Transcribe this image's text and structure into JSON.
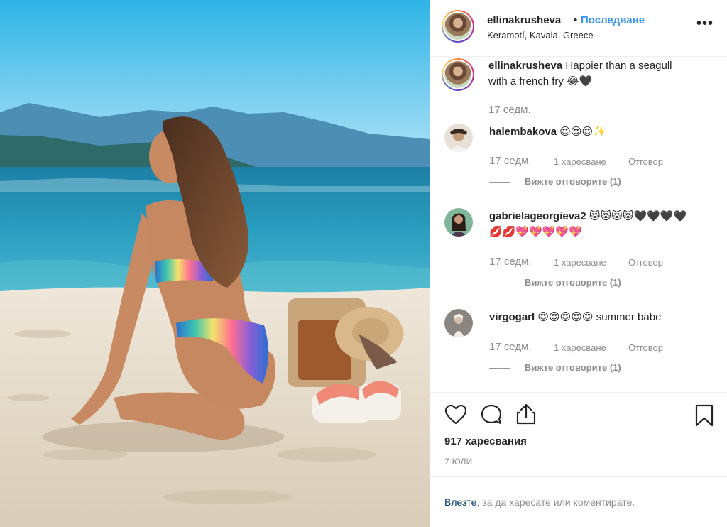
{
  "post": {
    "username": "ellinakrusheva",
    "separator": "•",
    "follow_label": "Последване",
    "location": "Keramotí, Kavala, Greece",
    "more_label": "•••"
  },
  "caption": {
    "username": "ellinakrusheva",
    "text": " Happier than a seagull",
    "text_line2": "with a french fry 😂🖤",
    "time": "17 седм."
  },
  "comments": [
    {
      "username": "halembakova",
      "text": " 😍😍😍✨",
      "time": "17 седм.",
      "likes": "1 харесване",
      "reply": "Отговор",
      "view_replies": "Вижте отговорите (1)"
    },
    {
      "username": "gabrielageorgieva2",
      "text": " 😻😻😻😻🖤🖤🖤🖤",
      "text_line2": "💋💋💖💖💖💖💖",
      "time": "17 седм.",
      "likes": "1 харесване",
      "reply": "Отговор",
      "view_replies": "Вижте отговорите (1)"
    },
    {
      "username": "virgogarl",
      "text": " 😍😍😍😍😍 summer babe",
      "time": "17 седм.",
      "likes": "1 харесване",
      "reply": "Отговор",
      "view_replies": "Вижте отговорите (1)"
    }
  ],
  "stats": {
    "likes": "917 харесвания",
    "date": "7 ЮЛИ"
  },
  "login_prompt": {
    "link": "Влезте",
    "text": ", за да харесате или коментирате."
  },
  "icons": {
    "like": "heart-icon",
    "comment": "comment-bubble-icon",
    "share": "share-icon",
    "save": "bookmark-icon"
  },
  "colors": {
    "link_blue": "#3897f0",
    "login_link": "#003569",
    "muted": "#8e8e8e",
    "text": "#262626"
  }
}
